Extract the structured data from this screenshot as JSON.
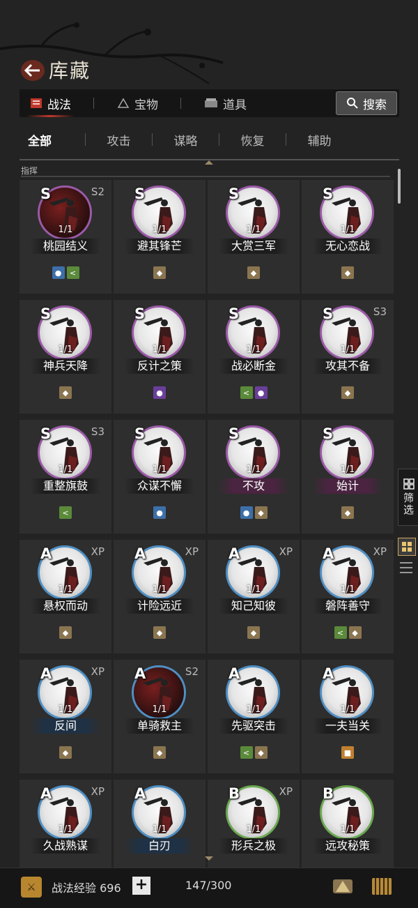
{
  "header": {
    "title": "库藏"
  },
  "tabs": [
    {
      "label": "战法",
      "icon": "scroll-icon",
      "active": true
    },
    {
      "label": "宝物",
      "icon": "treasure-icon",
      "active": false
    },
    {
      "label": "道具",
      "icon": "item-icon",
      "active": false
    }
  ],
  "search": {
    "label": "搜索"
  },
  "subtabs": [
    "全部",
    "攻击",
    "谋略",
    "恢复",
    "辅助"
  ],
  "section": {
    "label": "指挥"
  },
  "cards": [
    {
      "grade": "S",
      "tier": "S2",
      "count": "1/1",
      "name": "桃园结义",
      "frame": "purple",
      "portrait": "dark",
      "name_style": "",
      "badges": [
        "blue",
        "green"
      ]
    },
    {
      "grade": "S",
      "tier": "",
      "count": "1/1",
      "name": "避其锋芒",
      "frame": "purple",
      "portrait": "light",
      "name_style": "",
      "badges": [
        "bag"
      ]
    },
    {
      "grade": "S",
      "tier": "",
      "count": "1/1",
      "name": "大赏三军",
      "frame": "purple",
      "portrait": "light",
      "name_style": "",
      "badges": [
        "bag"
      ]
    },
    {
      "grade": "S",
      "tier": "",
      "count": "1/1",
      "name": "无心恋战",
      "frame": "purple",
      "portrait": "light",
      "name_style": "",
      "badges": [
        "bag"
      ]
    },
    {
      "grade": "S",
      "tier": "",
      "count": "1/1",
      "name": "神兵天降",
      "frame": "purple",
      "portrait": "light",
      "name_style": "",
      "badges": [
        "bag"
      ]
    },
    {
      "grade": "S",
      "tier": "",
      "count": "1/1",
      "name": "反计之策",
      "frame": "purple",
      "portrait": "light",
      "name_style": "",
      "badges": [
        "purple"
      ]
    },
    {
      "grade": "S",
      "tier": "",
      "count": "1/1",
      "name": "战必断金",
      "frame": "purple",
      "portrait": "light",
      "name_style": "",
      "badges": [
        "green",
        "purple"
      ]
    },
    {
      "grade": "S",
      "tier": "S3",
      "count": "1/1",
      "name": "攻其不备",
      "frame": "purple",
      "portrait": "light",
      "name_style": "",
      "badges": [
        "bag"
      ]
    },
    {
      "grade": "S",
      "tier": "S3",
      "count": "1/1",
      "name": "重整旗鼓",
      "frame": "purple",
      "portrait": "light",
      "name_style": "",
      "badges": [
        "green"
      ]
    },
    {
      "grade": "S",
      "tier": "",
      "count": "1/1",
      "name": "众谋不懈",
      "frame": "purple",
      "portrait": "light",
      "name_style": "",
      "badges": [
        "blue"
      ]
    },
    {
      "grade": "S",
      "tier": "",
      "count": "1/1",
      "name": "不攻",
      "frame": "purple",
      "portrait": "light",
      "name_style": "purple",
      "badges": [
        "blue",
        "bag"
      ]
    },
    {
      "grade": "S",
      "tier": "",
      "count": "1/1",
      "name": "始计",
      "frame": "purple",
      "portrait": "light",
      "name_style": "purple",
      "badges": [
        "bag"
      ]
    },
    {
      "grade": "A",
      "tier": "XP",
      "count": "1/1",
      "name": "悬权而动",
      "frame": "blue",
      "portrait": "light",
      "name_style": "",
      "badges": [
        "bag"
      ]
    },
    {
      "grade": "A",
      "tier": "XP",
      "count": "1/1",
      "name": "计险远近",
      "frame": "blue",
      "portrait": "light",
      "name_style": "",
      "badges": [
        "bag"
      ]
    },
    {
      "grade": "A",
      "tier": "XP",
      "count": "1/1",
      "name": "知己知彼",
      "frame": "blue",
      "portrait": "light",
      "name_style": "",
      "badges": [
        "bag"
      ]
    },
    {
      "grade": "A",
      "tier": "XP",
      "count": "1/1",
      "name": "磐阵善守",
      "frame": "blue",
      "portrait": "light",
      "name_style": "",
      "badges": [
        "green",
        "bag"
      ]
    },
    {
      "grade": "A",
      "tier": "XP",
      "count": "1/1",
      "name": "反间",
      "frame": "blue",
      "portrait": "light",
      "name_style": "blue",
      "badges": [
        "bag"
      ]
    },
    {
      "grade": "A",
      "tier": "S2",
      "count": "1/1",
      "name": "单骑救主",
      "frame": "blue",
      "portrait": "dark",
      "name_style": "",
      "badges": [
        "bag"
      ]
    },
    {
      "grade": "A",
      "tier": "",
      "count": "1/1",
      "name": "先驱突击",
      "frame": "blue",
      "portrait": "light",
      "name_style": "",
      "badges": [
        "green",
        "bag"
      ]
    },
    {
      "grade": "A",
      "tier": "",
      "count": "1/1",
      "name": "一夫当关",
      "frame": "blue",
      "portrait": "light",
      "name_style": "",
      "badges": [
        "orange"
      ]
    },
    {
      "grade": "A",
      "tier": "XP",
      "count": "1/1",
      "name": "久战熟谋",
      "frame": "blue",
      "portrait": "light",
      "name_style": "",
      "badges": []
    },
    {
      "grade": "A",
      "tier": "",
      "count": "1/1",
      "name": "白刃",
      "frame": "blue",
      "portrait": "light",
      "name_style": "blue",
      "badges": []
    },
    {
      "grade": "B",
      "tier": "XP",
      "count": "1/1",
      "name": "形兵之极",
      "frame": "green",
      "portrait": "light",
      "name_style": "",
      "badges": []
    },
    {
      "grade": "B",
      "tier": "",
      "count": "1/1",
      "name": "远攻秘策",
      "frame": "green",
      "portrait": "light",
      "name_style": "",
      "badges": []
    }
  ],
  "side": {
    "filter_label": "筛选"
  },
  "footer": {
    "exp_label": "战法经验 696",
    "plus": "+",
    "capacity": "147/300"
  }
}
